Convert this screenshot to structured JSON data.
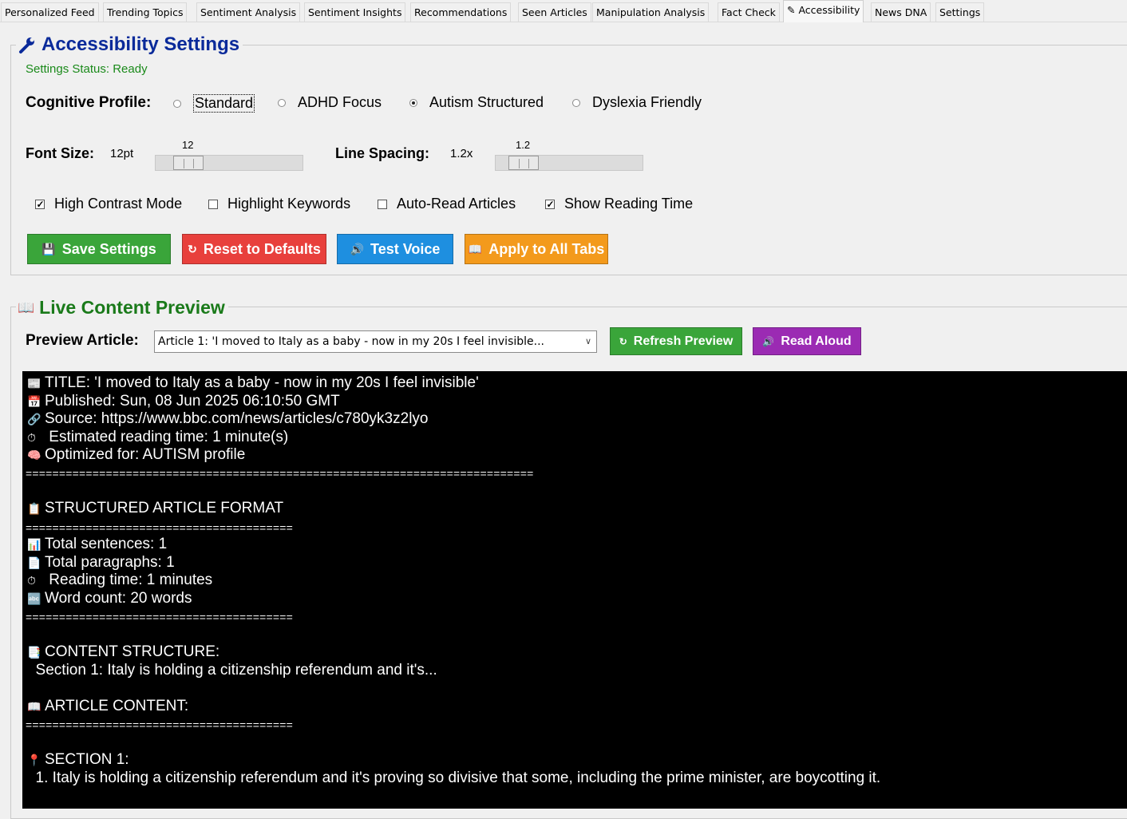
{
  "tabs": [
    {
      "label": "Personalized Feed"
    },
    {
      "label": "Trending Topics"
    },
    {
      "label": "Sentiment Analysis"
    },
    {
      "label": "Sentiment Insights"
    },
    {
      "label": "Recommendations"
    },
    {
      "label": "Seen Articles"
    },
    {
      "label": "Manipulation Analysis"
    },
    {
      "label": "Fact Check"
    },
    {
      "label": "✎ Accessibility"
    },
    {
      "label": "News DNA"
    },
    {
      "label": "Settings"
    }
  ],
  "accessibility": {
    "icon": "wrench-icon",
    "title": "Accessibility Settings",
    "status": "Settings Status: Ready",
    "cognitive_label": "Cognitive Profile:",
    "profiles": [
      {
        "label": "Standard",
        "selected": false
      },
      {
        "label": "ADHD Focus",
        "selected": false
      },
      {
        "label": "Autism Structured",
        "selected": true
      },
      {
        "label": "Dyslexia Friendly",
        "selected": false
      }
    ],
    "font_size_label": "Font Size:",
    "font_size_value": "12pt",
    "font_size_slider": 12,
    "line_spacing_label": "Line Spacing:",
    "line_spacing_value": "1.2x",
    "line_spacing_slider": 1.2,
    "checks": [
      {
        "label": "High Contrast Mode",
        "checked": true
      },
      {
        "label": "Highlight Keywords",
        "checked": false
      },
      {
        "label": "Auto-Read Articles",
        "checked": false
      },
      {
        "label": "Show Reading Time",
        "checked": true
      }
    ],
    "buttons": {
      "save": "Save Settings",
      "reset": "Reset to Defaults",
      "test_voice": "Test Voice",
      "apply_all": "Apply to All Tabs"
    },
    "colors": {
      "save": "#3aa53a",
      "reset": "#e8403c",
      "test_voice": "#1e8fe0",
      "apply_all": "#f39a1c",
      "refresh": "#3aa53a",
      "read_aloud": "#9b2bb3",
      "title": "#0a2a9a",
      "preview_title": "#1a7a1a"
    }
  },
  "preview": {
    "icon": "book-icon",
    "title": "Live Content Preview",
    "article_label": "Preview Article:",
    "selected_article": "Article 1: 'I moved to Italy as a baby - now in my 20s I feel invisible...",
    "refresh_label": "Refresh Preview",
    "read_aloud_label": "Read Aloud",
    "lines": {
      "title": "TITLE: 'I moved to Italy as a baby - now in my 20s I feel invisible'",
      "published": "Published: Sun, 08 Jun 2025 06:10:50 GMT",
      "source": "Source: https://www.bbc.com/news/articles/c780yk3z2lyo",
      "reading_est": " Estimated reading time: 1 minute(s)",
      "optimized": "Optimized for: AUTISM profile",
      "sep_long": "============================================================================",
      "structured": "STRUCTURED ARTICLE FORMAT",
      "sep_short": "========================================",
      "sentences": "Total sentences: 1",
      "paragraphs": "Total paragraphs: 1",
      "reading_time": " Reading time: 1 minutes",
      "word_count": "Word count: 20 words",
      "content_structure": "CONTENT STRUCTURE:",
      "section_summary": "  Section 1: Italy is holding a citizenship referendum and it's...",
      "article_content": "ARTICLE CONTENT:",
      "section_heading": "SECTION 1:",
      "section_text": "  1. Italy is holding a citizenship referendum and it's proving so divisive that some, including the prime minister, are boycotting it."
    }
  }
}
